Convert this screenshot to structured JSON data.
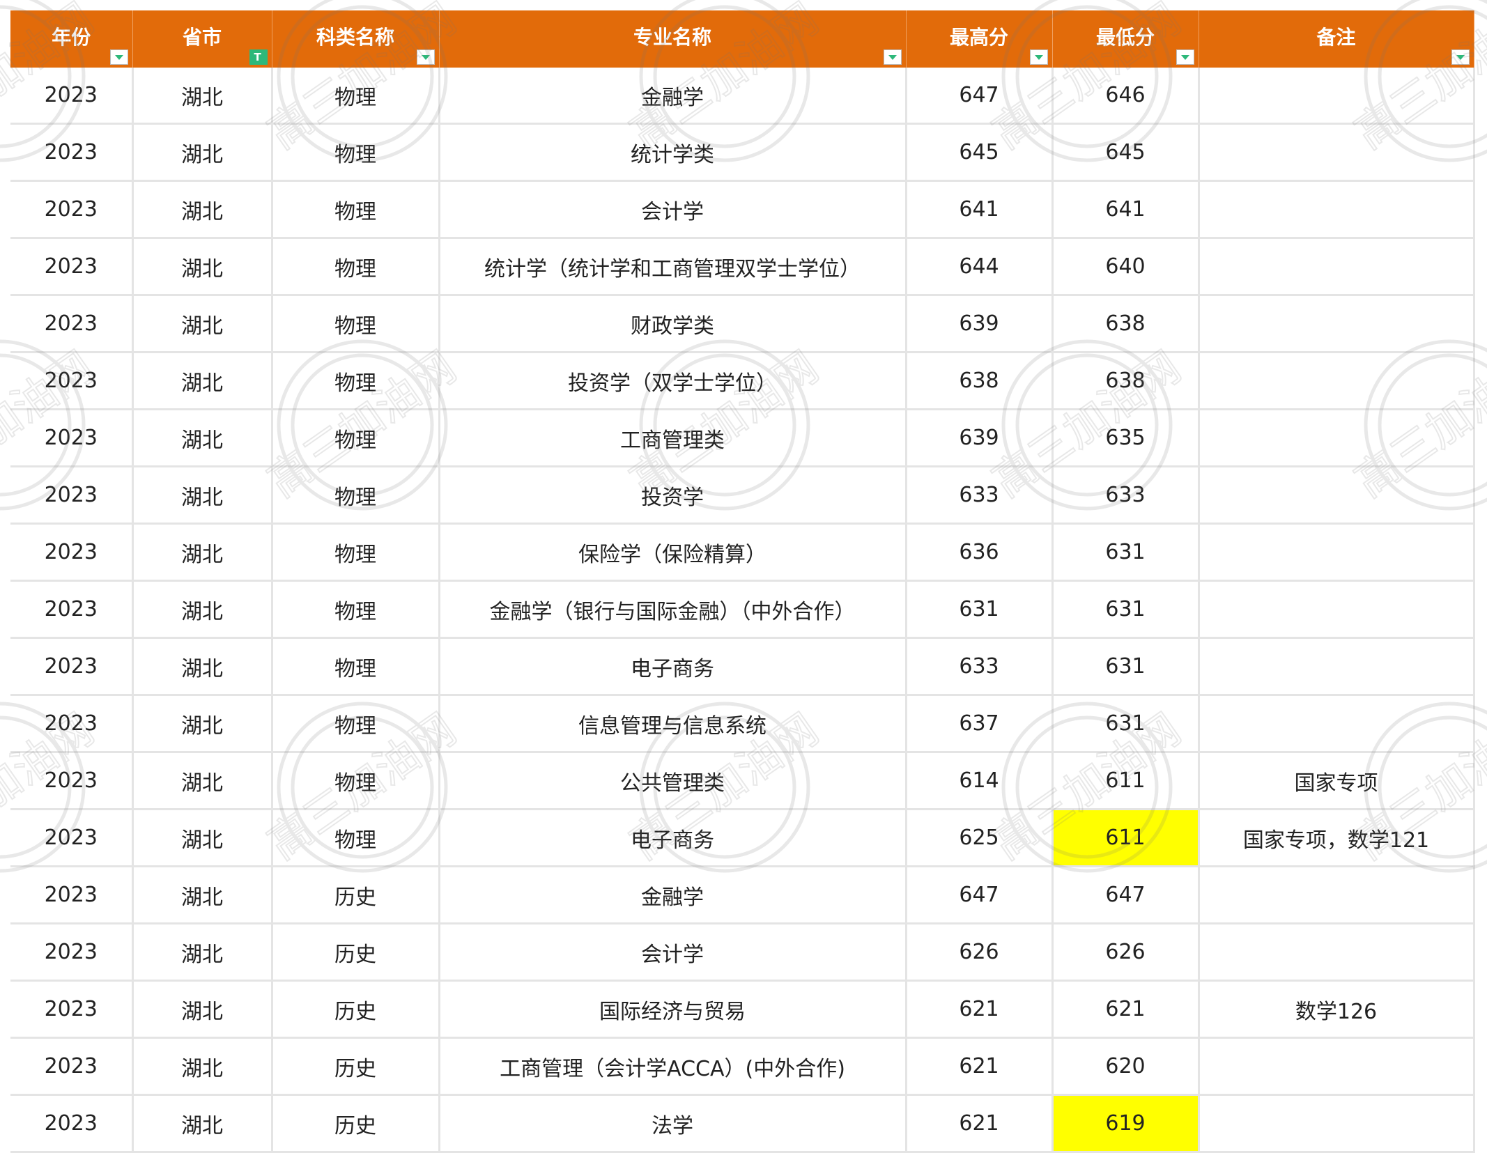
{
  "table": {
    "headers": [
      {
        "label": "年份",
        "filter": "normal"
      },
      {
        "label": "省市",
        "filter": "active"
      },
      {
        "label": "科类名称",
        "filter": "normal"
      },
      {
        "label": "专业名称",
        "filter": "normal"
      },
      {
        "label": "最高分",
        "filter": "normal"
      },
      {
        "label": "最低分",
        "filter": "normal"
      },
      {
        "label": "备注",
        "filter": "normal"
      }
    ],
    "rows": [
      [
        "2023",
        "湖北",
        "物理",
        "金融学",
        "647",
        "646",
        ""
      ],
      [
        "2023",
        "湖北",
        "物理",
        "统计学类",
        "645",
        "645",
        ""
      ],
      [
        "2023",
        "湖北",
        "物理",
        "会计学",
        "641",
        "641",
        ""
      ],
      [
        "2023",
        "湖北",
        "物理",
        "统计学（统计学和工商管理双学士学位）",
        "644",
        "640",
        ""
      ],
      [
        "2023",
        "湖北",
        "物理",
        "财政学类",
        "639",
        "638",
        ""
      ],
      [
        "2023",
        "湖北",
        "物理",
        "投资学（双学士学位）",
        "638",
        "638",
        ""
      ],
      [
        "2023",
        "湖北",
        "物理",
        "工商管理类",
        "639",
        "635",
        ""
      ],
      [
        "2023",
        "湖北",
        "物理",
        "投资学",
        "633",
        "633",
        ""
      ],
      [
        "2023",
        "湖北",
        "物理",
        "保险学（保险精算）",
        "636",
        "631",
        ""
      ],
      [
        "2023",
        "湖北",
        "物理",
        "金融学（银行与国际金融）（中外合作）",
        "631",
        "631",
        ""
      ],
      [
        "2023",
        "湖北",
        "物理",
        "电子商务",
        "633",
        "631",
        ""
      ],
      [
        "2023",
        "湖北",
        "物理",
        "信息管理与信息系统",
        "637",
        "631",
        ""
      ],
      [
        "2023",
        "湖北",
        "物理",
        "公共管理类",
        "614",
        "611",
        "国家专项"
      ],
      [
        "2023",
        "湖北",
        "物理",
        "电子商务",
        "625",
        "611",
        "国家专项，数学121"
      ],
      [
        "2023",
        "湖北",
        "历史",
        "金融学",
        "647",
        "647",
        ""
      ],
      [
        "2023",
        "湖北",
        "历史",
        "会计学",
        "626",
        "626",
        ""
      ],
      [
        "2023",
        "湖北",
        "历史",
        "国际经济与贸易",
        "621",
        "621",
        "数学126"
      ],
      [
        "2023",
        "湖北",
        "历史",
        "工商管理（会计学ACCA）(中外合作)",
        "621",
        "620",
        ""
      ],
      [
        "2023",
        "湖北",
        "历史",
        "法学",
        "621",
        "619",
        ""
      ]
    ],
    "highlighted_cells": [
      {
        "row": 13,
        "col": 5,
        "color": "#ffff00"
      },
      {
        "row": 18,
        "col": 5,
        "color": "#ffff00"
      }
    ]
  },
  "watermark": {
    "text": "高三加油网"
  },
  "colors": {
    "header_bg": "#e26b0a",
    "header_text": "#ffffff",
    "highlight": "#ffff00",
    "grid": "#e4e4e4"
  }
}
